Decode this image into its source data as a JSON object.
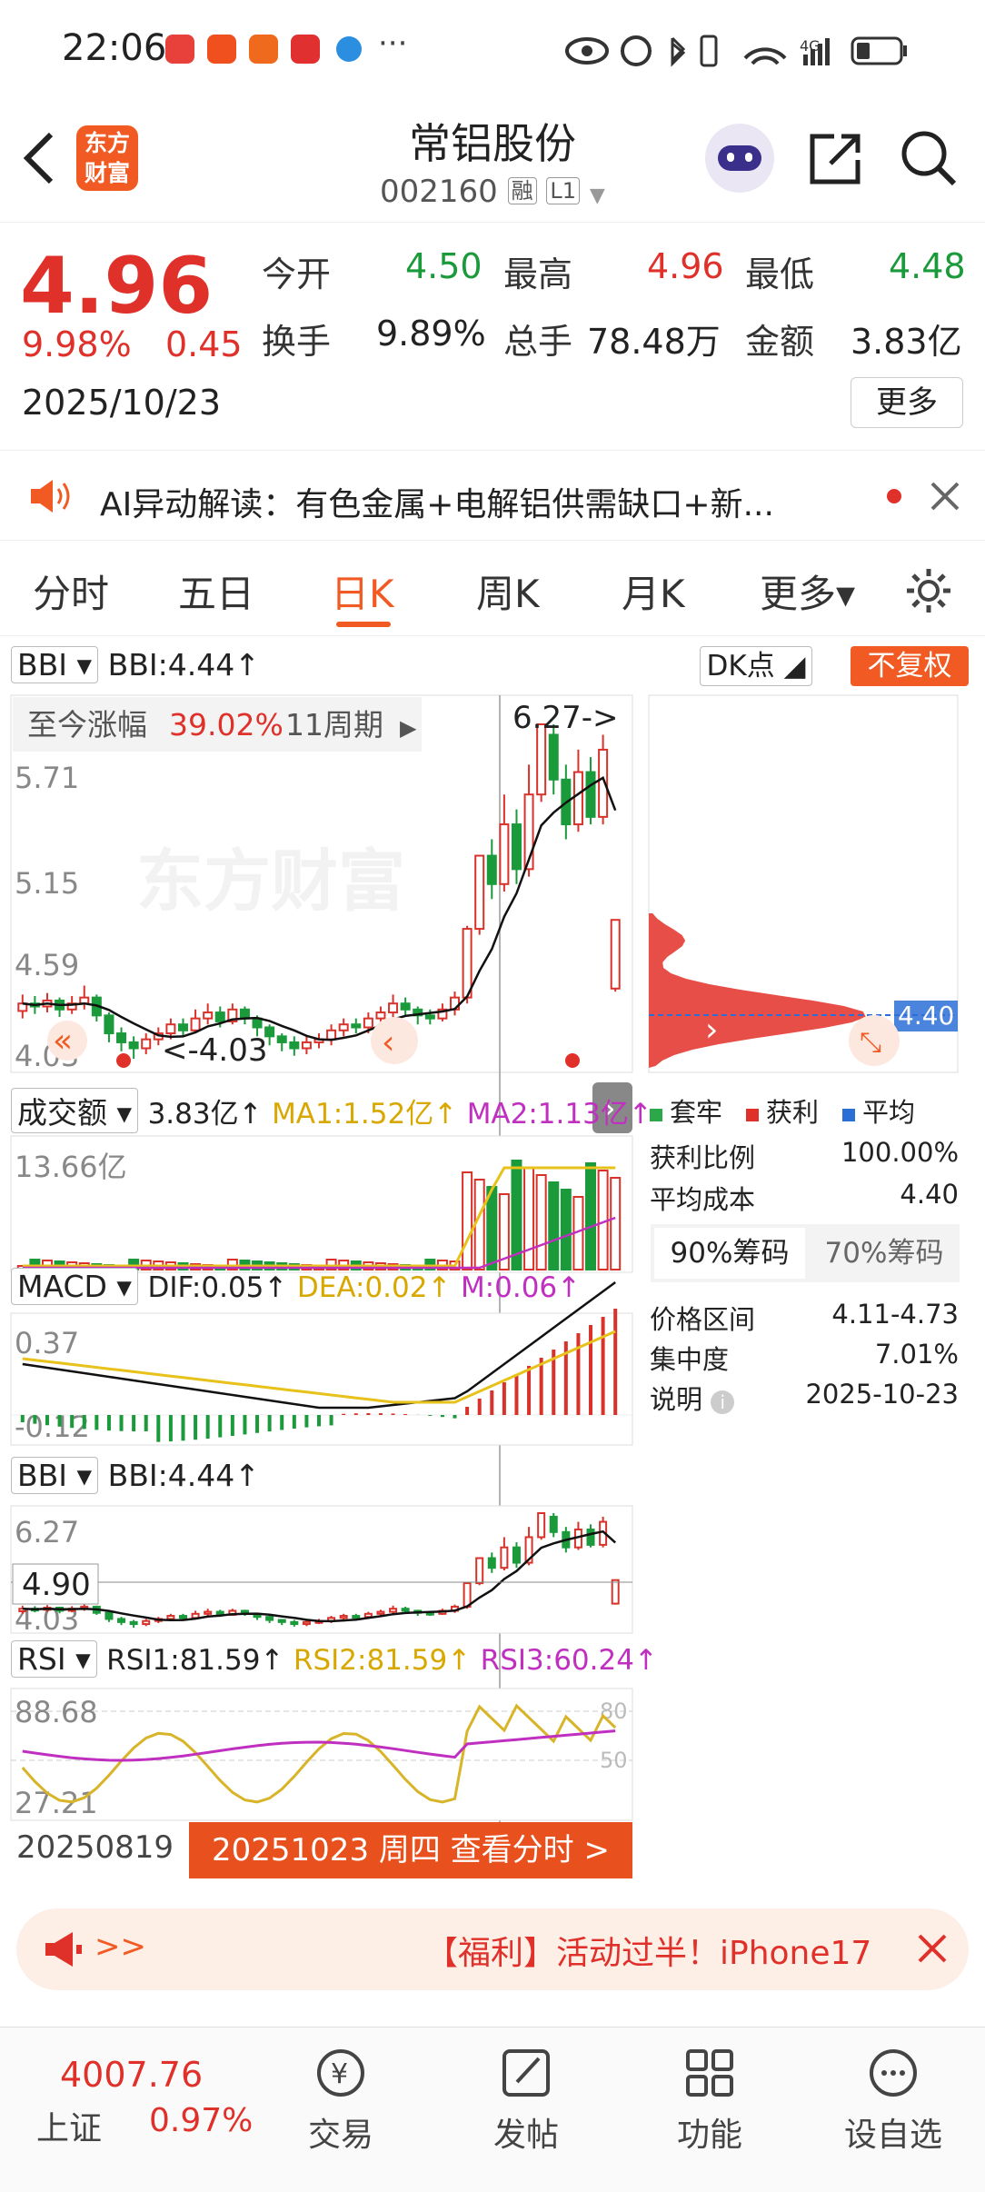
{
  "status_bar": {
    "time": "22:06",
    "dots": "···",
    "network": "4G"
  },
  "header": {
    "back_label": "<",
    "logo_text": [
      "东方",
      "财富"
    ],
    "stock_name": "常铝股份",
    "stock_code": "002160",
    "badge_margin": "融",
    "badge_level": "L1"
  },
  "quote": {
    "price": "4.96",
    "change_pct": "9.98%",
    "change_amt": "0.45",
    "date": "2025/10/23",
    "metrics": [
      {
        "label": "今开",
        "value": "4.50",
        "color": "green"
      },
      {
        "label": "最高",
        "value": "4.96",
        "color": "red"
      },
      {
        "label": "最低",
        "value": "4.48",
        "color": "green"
      },
      {
        "label": "换手",
        "value": "9.89%",
        "color": "black"
      },
      {
        "label": "总手",
        "value": "78.48万",
        "color": "black"
      },
      {
        "label": "金额",
        "value": "3.83亿",
        "color": "black"
      }
    ],
    "more_button": "更多"
  },
  "notice": {
    "text": "AI异动解读：有色金属+电解铝供需缺口+新..."
  },
  "tabs": [
    {
      "label": "分时",
      "active": false
    },
    {
      "label": "五日",
      "active": false
    },
    {
      "label": "日K",
      "active": true
    },
    {
      "label": "周K",
      "active": false
    },
    {
      "label": "月K",
      "active": false
    },
    {
      "label": "更多▾",
      "active": false
    }
  ],
  "chart": {
    "main_indicator": {
      "name": "BBI",
      "text": "BBI:4.44↑"
    },
    "dk_button": "DK点",
    "fq_button": "不复权",
    "gain_label": "至今涨幅",
    "gain_value": "39.02%",
    "gain_period": "11周期",
    "max_marker": "6.27->",
    "min_marker": "<-4.03",
    "y_labels": [
      "5.71",
      "5.15",
      "4.59",
      "4.03"
    ],
    "watermark": "东方财富",
    "volume": {
      "name": "成交额",
      "value": "3.83亿↑",
      "ma1": "MA1:1.52亿↑",
      "ma2": "MA2:1.13亿↑",
      "max_label": "13.66亿"
    },
    "macd": {
      "name": "MACD",
      "dif": "DIF:0.05↑",
      "dea": "DEA:0.02↑",
      "m": "M:0.06↑",
      "top": "0.37",
      "bottom": "-0.12"
    },
    "bbi": {
      "name": "BBI",
      "text": "BBI:4.44↑",
      "top": "6.27",
      "cursor": "4.90",
      "bottom": "4.03"
    },
    "rsi": {
      "name": "RSI",
      "rsi1": "RSI1:81.59↑",
      "rsi2": "RSI2:81.59↑",
      "rsi3": "RSI3:60.24↑",
      "top": "88.68",
      "bottom": "27.21",
      "line80": "80",
      "line50": "50"
    },
    "start_date": "20250819",
    "cursor_label": "20251023 周四 查看分时 >"
  },
  "chip": {
    "price_tag": "4.40",
    "legend": [
      "套牢",
      "获利",
      "平均"
    ],
    "legend_colors": [
      "#2aa84a",
      "#e0302a",
      "#2b6fd6"
    ],
    "rows": [
      {
        "label": "获利比例",
        "value": "100.00%"
      },
      {
        "label": "平均成本",
        "value": "4.40"
      }
    ],
    "tabs": [
      "90%筹码",
      "70%筹码"
    ],
    "rows2": [
      {
        "label": "价格区间",
        "value": "4.11-4.73"
      },
      {
        "label": "集中度",
        "value": "7.01%"
      },
      {
        "label": "说明",
        "value": "2025-10-23"
      }
    ]
  },
  "promo": {
    "left": ">>",
    "text": "【福利】活动过半！iPhone17"
  },
  "bottom_bar": {
    "index_value": "4007.76",
    "index_name": "上证",
    "index_pct": "0.97%",
    "items": [
      {
        "label": "交易",
        "icon": "trade-icon"
      },
      {
        "label": "发帖",
        "icon": "post-icon"
      },
      {
        "label": "功能",
        "icon": "apps-icon"
      },
      {
        "label": "设自选",
        "icon": "add-watchlist-icon"
      }
    ]
  },
  "chart_data": {
    "type": "candlestick",
    "start": "20250819",
    "end": "20251023",
    "ylim": [
      4.03,
      6.27
    ],
    "candles": [
      [
        4.35,
        4.4,
        4.3,
        4.46
      ],
      [
        4.4,
        4.38,
        4.33,
        4.45
      ],
      [
        4.38,
        4.42,
        4.34,
        4.47
      ],
      [
        4.42,
        4.36,
        4.31,
        4.44
      ],
      [
        4.36,
        4.4,
        4.33,
        4.45
      ],
      [
        4.4,
        4.44,
        4.36,
        4.52
      ],
      [
        4.44,
        4.32,
        4.28,
        4.46
      ],
      [
        4.32,
        4.2,
        4.14,
        4.34
      ],
      [
        4.2,
        4.14,
        4.08,
        4.24
      ],
      [
        4.14,
        4.1,
        4.03,
        4.18
      ],
      [
        4.1,
        4.16,
        4.06,
        4.2
      ],
      [
        4.16,
        4.2,
        4.12,
        4.24
      ],
      [
        4.2,
        4.26,
        4.16,
        4.3
      ],
      [
        4.26,
        4.22,
        4.18,
        4.3
      ],
      [
        4.22,
        4.3,
        4.2,
        4.36
      ],
      [
        4.3,
        4.34,
        4.26,
        4.4
      ],
      [
        4.34,
        4.28,
        4.24,
        4.38
      ],
      [
        4.28,
        4.36,
        4.26,
        4.4
      ],
      [
        4.36,
        4.3,
        4.26,
        4.38
      ],
      [
        4.3,
        4.24,
        4.18,
        4.32
      ],
      [
        4.24,
        4.18,
        4.12,
        4.26
      ],
      [
        4.18,
        4.14,
        4.08,
        4.2
      ],
      [
        4.14,
        4.1,
        4.05,
        4.18
      ],
      [
        4.1,
        4.14,
        4.06,
        4.18
      ],
      [
        4.14,
        4.16,
        4.1,
        4.2
      ],
      [
        4.16,
        4.22,
        4.12,
        4.26
      ],
      [
        4.22,
        4.26,
        4.18,
        4.3
      ],
      [
        4.26,
        4.24,
        4.2,
        4.3
      ],
      [
        4.24,
        4.3,
        4.2,
        4.34
      ],
      [
        4.3,
        4.34,
        4.26,
        4.38
      ],
      [
        4.34,
        4.4,
        4.3,
        4.46
      ],
      [
        4.4,
        4.36,
        4.32,
        4.44
      ],
      [
        4.36,
        4.32,
        4.26,
        4.38
      ],
      [
        4.32,
        4.3,
        4.26,
        4.36
      ],
      [
        4.3,
        4.36,
        4.28,
        4.4
      ],
      [
        4.36,
        4.44,
        4.32,
        4.48
      ],
      [
        4.44,
        4.9,
        4.4,
        4.92
      ],
      [
        4.9,
        5.39,
        4.86,
        5.39
      ],
      [
        5.39,
        5.2,
        5.1,
        5.5
      ],
      [
        5.2,
        5.6,
        5.15,
        5.8
      ],
      [
        5.6,
        5.3,
        5.2,
        5.7
      ],
      [
        5.3,
        5.8,
        5.25,
        6.0
      ],
      [
        5.8,
        6.27,
        5.75,
        6.27
      ],
      [
        6.2,
        5.9,
        5.8,
        6.27
      ],
      [
        5.9,
        5.6,
        5.5,
        6.0
      ],
      [
        5.6,
        5.95,
        5.55,
        6.1
      ],
      [
        5.95,
        5.65,
        5.6,
        6.05
      ],
      [
        5.65,
        6.1,
        5.6,
        6.2
      ],
      [
        4.5,
        4.96,
        4.48,
        4.96
      ]
    ]
  }
}
